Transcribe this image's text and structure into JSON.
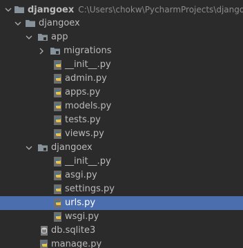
{
  "tree": {
    "root": {
      "name": "djangoex",
      "path": "C:\\Users\\chokw\\PycharmProjects\\djangoex",
      "icon": "folder-icon"
    },
    "items": [
      {
        "label": "djangoex",
        "icon": "folder-icon",
        "state": "expanded"
      },
      {
        "label": "app",
        "icon": "package-folder-icon",
        "state": "expanded"
      },
      {
        "label": "migrations",
        "icon": "package-folder-icon",
        "state": "collapsed"
      },
      {
        "label": "__init__.py",
        "icon": "python-file-icon"
      },
      {
        "label": "admin.py",
        "icon": "python-file-icon"
      },
      {
        "label": "apps.py",
        "icon": "python-file-icon"
      },
      {
        "label": "models.py",
        "icon": "python-file-icon"
      },
      {
        "label": "tests.py",
        "icon": "python-file-icon"
      },
      {
        "label": "views.py",
        "icon": "python-file-icon"
      },
      {
        "label": "djangoex",
        "icon": "package-folder-icon",
        "state": "expanded"
      },
      {
        "label": "__init__.py",
        "icon": "python-file-icon"
      },
      {
        "label": "asgi.py",
        "icon": "python-file-icon"
      },
      {
        "label": "settings.py",
        "icon": "python-file-icon"
      },
      {
        "label": "urls.py",
        "icon": "python-file-icon",
        "selected": true
      },
      {
        "label": "wsgi.py",
        "icon": "python-file-icon"
      },
      {
        "label": "db.sqlite3",
        "icon": "database-file-icon"
      },
      {
        "label": "manage.py",
        "icon": "python-file-icon"
      }
    ]
  },
  "colors": {
    "background": "#2b2b2b",
    "selection": "#4b6eaf",
    "text": "#bbbbbb",
    "folder": "#87939a",
    "python_blue": "#3a76b0",
    "python_yellow": "#f2c037"
  }
}
